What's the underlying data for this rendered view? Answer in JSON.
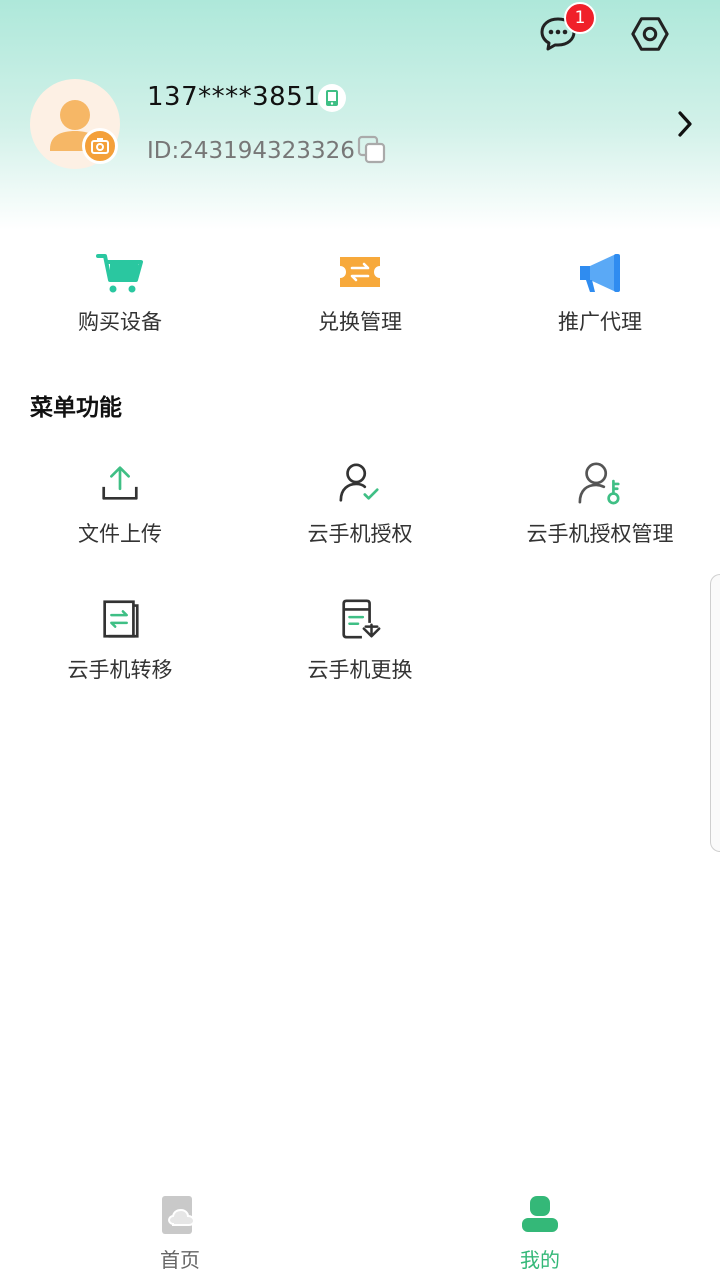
{
  "header": {
    "messages_badge": "1",
    "phone_number": "137****3851",
    "user_id": "ID:243194323326"
  },
  "quick_actions": [
    {
      "label": "购买设备",
      "icon": "shopping-cart-icon"
    },
    {
      "label": "兑换管理",
      "icon": "ticket-exchange-icon"
    },
    {
      "label": "推广代理",
      "icon": "megaphone-icon"
    }
  ],
  "menu": {
    "title": "菜单功能",
    "items": [
      {
        "label": "文件上传",
        "icon": "upload-icon"
      },
      {
        "label": "云手机授权",
        "icon": "user-check-icon"
      },
      {
        "label": "云手机授权管理",
        "icon": "user-key-icon"
      },
      {
        "label": "云手机转移",
        "icon": "transfer-icon"
      },
      {
        "label": "云手机更换",
        "icon": "replace-icon"
      }
    ]
  },
  "bottom_nav": {
    "home_label": "首页",
    "mine_label": "我的"
  },
  "colors": {
    "accent": "#34b878",
    "badge": "#f0202a",
    "cart": "#2ac7a0",
    "ticket": "#f7a93b",
    "megaphone": "#2f8cf0"
  }
}
